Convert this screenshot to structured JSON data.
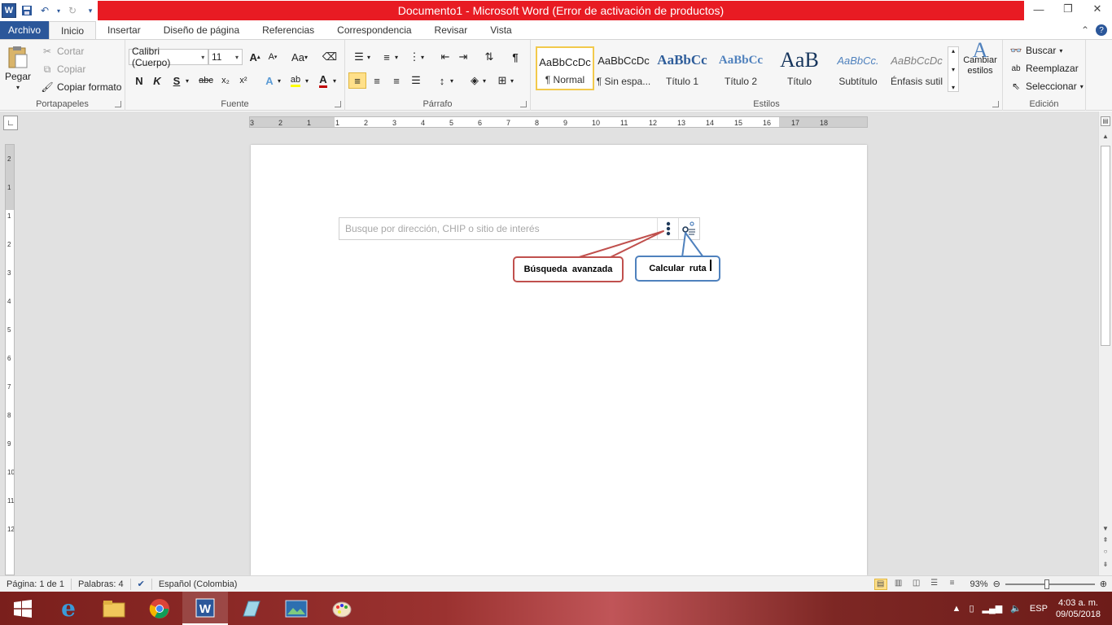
{
  "window": {
    "title": "Documento1  -  Microsoft Word (Error de activación de productos)",
    "title_bar_color": "#e81b23"
  },
  "qat": {
    "icons": [
      "word-icon",
      "save-icon",
      "undo-icon",
      "redo-icon",
      "customize-icon"
    ]
  },
  "tabs": {
    "file": "Archivo",
    "items": [
      "Inicio",
      "Insertar",
      "Diseño de página",
      "Referencias",
      "Correspondencia",
      "Revisar",
      "Vista"
    ],
    "active": "Inicio",
    "file_color": "#2b579a"
  },
  "clipboard": {
    "paste": "Pegar",
    "cut": "Cortar",
    "copy": "Copiar",
    "format_painter": "Copiar formato",
    "label": "Portapapeles"
  },
  "font": {
    "family": "Calibri (Cuerpo)",
    "size": "11",
    "label": "Fuente",
    "bold": "N",
    "italic": "K",
    "underline": "S",
    "strike": "abc",
    "subscript": "x₂",
    "superscript": "x²",
    "grow": "A",
    "shrink": "A",
    "case": "Aa",
    "color_red": "#c00000"
  },
  "paragraph": {
    "label": "Párrafo",
    "pilcrow": "¶"
  },
  "styles": {
    "label": "Estilos",
    "items": [
      {
        "sample": "AaBbCcDc",
        "name": "¶ Normal"
      },
      {
        "sample": "AaBbCcDc",
        "name": "¶ Sin espa..."
      },
      {
        "sample": "AaBbCc",
        "name": "Título 1"
      },
      {
        "sample": "AaBbCc",
        "name": "Título 2"
      },
      {
        "sample": "AaB",
        "name": "Título"
      },
      {
        "sample": "AaBbCc.",
        "name": "Subtítulo"
      },
      {
        "sample": "AaBbCcDc",
        "name": "Énfasis sutil"
      }
    ],
    "change": "Cambiar estilos"
  },
  "editing": {
    "label": "Edición",
    "find": "Buscar",
    "replace": "Reemplazar",
    "select": "Seleccionar"
  },
  "ruler": {
    "h_numbers": [
      "3",
      "2",
      "1",
      "1",
      "2",
      "3",
      "4",
      "5",
      "6",
      "7",
      "8",
      "9",
      "10",
      "11",
      "12",
      "13",
      "14",
      "15",
      "16",
      "17",
      "18"
    ],
    "v_numbers": [
      "2",
      "1",
      "1",
      "2",
      "3",
      "4",
      "5",
      "6",
      "7",
      "8",
      "9",
      "10",
      "11",
      "12"
    ]
  },
  "document": {
    "search_placeholder": "Busque por dirección, CHIP o sitio de interés",
    "callout_advanced": "Búsqueda  avanzada",
    "callout_route": "Calcular  ruta",
    "callout_advanced_color": "#c0504d",
    "callout_route_color": "#4f81bd"
  },
  "status": {
    "page": "Página: 1 de 1",
    "words": "Palabras: 4",
    "language": "Español (Colombia)",
    "zoom": "93%"
  },
  "taskbar": {
    "lang": "ESP",
    "time": "4:03 a. m.",
    "date": "09/05/2018"
  }
}
